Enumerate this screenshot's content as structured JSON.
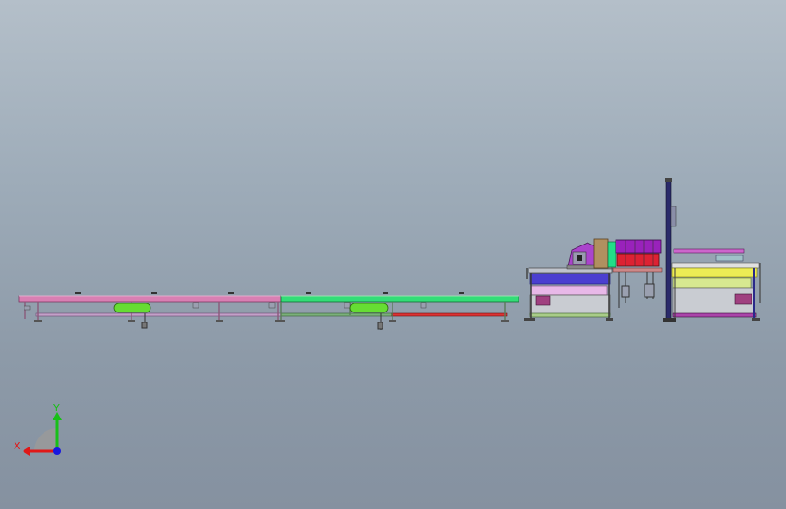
{
  "triad": {
    "x_label": "X",
    "y_label": "Y",
    "colors": {
      "x": "#e01818",
      "y": "#18c018",
      "z": "#1818e0"
    }
  },
  "model": {
    "colors": {
      "pink_rail": "#d97fb3",
      "green_rail": "#33dd77",
      "lime_pad": "#66dd33",
      "frame_blue": "#3a3aa0",
      "frame_purple": "#7733dd",
      "yellow": "#ecec55",
      "magenta": "#cc44cc",
      "red": "#dd2233",
      "cyan": "#22dddd"
    }
  }
}
